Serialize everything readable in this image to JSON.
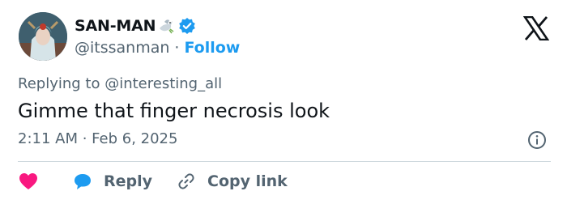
{
  "header": {
    "display_name": "SAN-MAN",
    "name_emoji": "dove-emoji",
    "verified_icon": "verified-badge-icon",
    "handle": "@itssanman",
    "separator": "·",
    "follow_label": "Follow",
    "platform_logo": "x-logo-icon"
  },
  "tweet": {
    "replying_to": "Replying to @interesting_all",
    "text": "Gimme that finger necrosis look",
    "timestamp": "2:11 AM · Feb 6, 2025"
  },
  "actions": {
    "like_icon": "heart-icon",
    "reply_label": "Reply",
    "reply_icon": "speech-bubble-icon",
    "copy_label": "Copy link",
    "copy_icon": "link-icon",
    "info_icon": "info-icon"
  },
  "colors": {
    "accent": "#1d9bf0",
    "like": "#f91880",
    "muted_text": "#536471",
    "text": "#0f1419",
    "divider": "#cfd9de"
  }
}
